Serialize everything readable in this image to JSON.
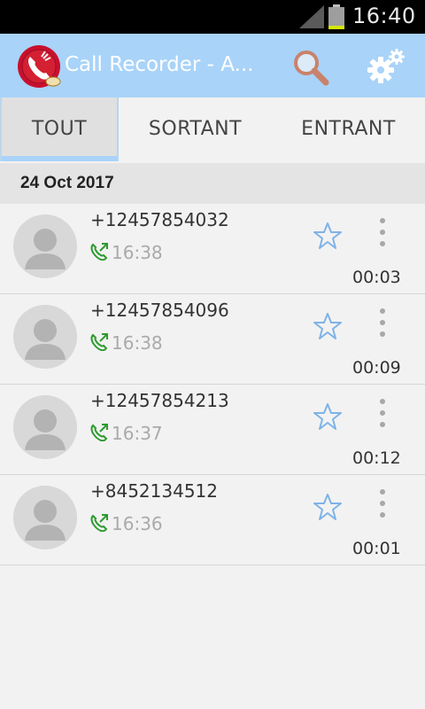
{
  "status_bar": {
    "time": "16:40",
    "icons": [
      "signal-icon",
      "battery-icon"
    ]
  },
  "app_bar": {
    "title": "Call Recorder - A...",
    "logo": "call-recorder-logo",
    "actions": [
      "search-icon",
      "gear-icon"
    ],
    "colors": {
      "background": "#a9d3f8",
      "title": "#ffffff"
    }
  },
  "tabs": [
    {
      "label": "TOUT",
      "active": true
    },
    {
      "label": "SORTANT",
      "active": false
    },
    {
      "label": "ENTRANT",
      "active": false
    }
  ],
  "date_header": "24 Oct 2017",
  "recordings": [
    {
      "number": "+12457854032",
      "time": "16:38",
      "duration": "00:03"
    },
    {
      "number": "+12457854096",
      "time": "16:38",
      "duration": "00:09"
    },
    {
      "number": "+12457854213",
      "time": "16:37",
      "duration": "00:12"
    },
    {
      "number": "+8452134512",
      "time": "16:36",
      "duration": "00:01"
    }
  ],
  "icons": {
    "call_type": "outgoing-call-icon",
    "favorite": "star-outline-icon",
    "overflow": "more-vert-icon",
    "contact": "default-avatar-icon"
  },
  "colors": {
    "call_icon": "#2e9a2e",
    "star": "#7fb3e6",
    "time_text": "#aaaaaa"
  }
}
